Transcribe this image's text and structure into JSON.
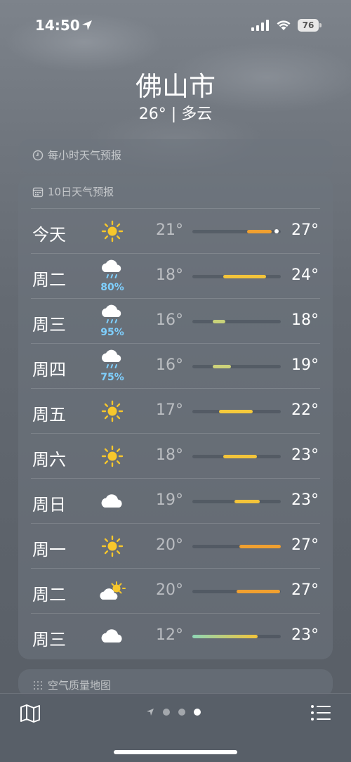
{
  "status": {
    "time": "14:50",
    "battery": "76"
  },
  "header": {
    "city": "佛山市",
    "summary": "26° | 多云"
  },
  "hourly": {
    "title": "每小时天气预报"
  },
  "daily": {
    "title": "10日天气预报",
    "days": [
      {
        "day": "今天",
        "icon": "sun-icon",
        "precip": "",
        "low": "21°",
        "high": "27°",
        "bar_start": 0.62,
        "bar_end": 0.9,
        "current": 0.93,
        "color": "#f0a030"
      },
      {
        "day": "周二",
        "icon": "rain-icon",
        "precip": "80%",
        "low": "18°",
        "high": "24°",
        "bar_start": 0.35,
        "bar_end": 0.83,
        "color": "#f3c43a"
      },
      {
        "day": "周三",
        "icon": "rain-icon",
        "precip": "95%",
        "low": "16°",
        "high": "18°",
        "bar_start": 0.23,
        "bar_end": 0.37,
        "color": "#c8d27a"
      },
      {
        "day": "周四",
        "icon": "rain-icon",
        "precip": "75%",
        "low": "16°",
        "high": "19°",
        "bar_start": 0.23,
        "bar_end": 0.44,
        "color": "#cdd27a"
      },
      {
        "day": "周五",
        "icon": "sun-icon",
        "precip": "",
        "low": "17°",
        "high": "22°",
        "bar_start": 0.3,
        "bar_end": 0.68,
        "color": "#f5ca3c"
      },
      {
        "day": "周六",
        "icon": "sun-icon",
        "precip": "",
        "low": "18°",
        "high": "23°",
        "bar_start": 0.35,
        "bar_end": 0.73,
        "color": "#f3c43a"
      },
      {
        "day": "周日",
        "icon": "cloud-icon",
        "precip": "",
        "low": "19°",
        "high": "23°",
        "bar_start": 0.48,
        "bar_end": 0.76,
        "color": "#f3c43a"
      },
      {
        "day": "周一",
        "icon": "sun-icon",
        "precip": "",
        "low": "20°",
        "high": "27°",
        "bar_start": 0.53,
        "bar_end": 1.0,
        "color": "#f0a030"
      },
      {
        "day": "周二",
        "icon": "partly-cloudy-icon",
        "precip": "",
        "low": "20°",
        "high": "27°",
        "bar_start": 0.5,
        "bar_end": 0.99,
        "color": "#f0a030"
      },
      {
        "day": "周三",
        "icon": "cloud-icon",
        "precip": "",
        "low": "12°",
        "high": "23°",
        "bar_start": 0.0,
        "bar_end": 0.74,
        "color": "linear-gradient(90deg,#8ed6b6,#f3c43a)"
      }
    ]
  },
  "air_quality": {
    "title": "空气质量地图"
  }
}
